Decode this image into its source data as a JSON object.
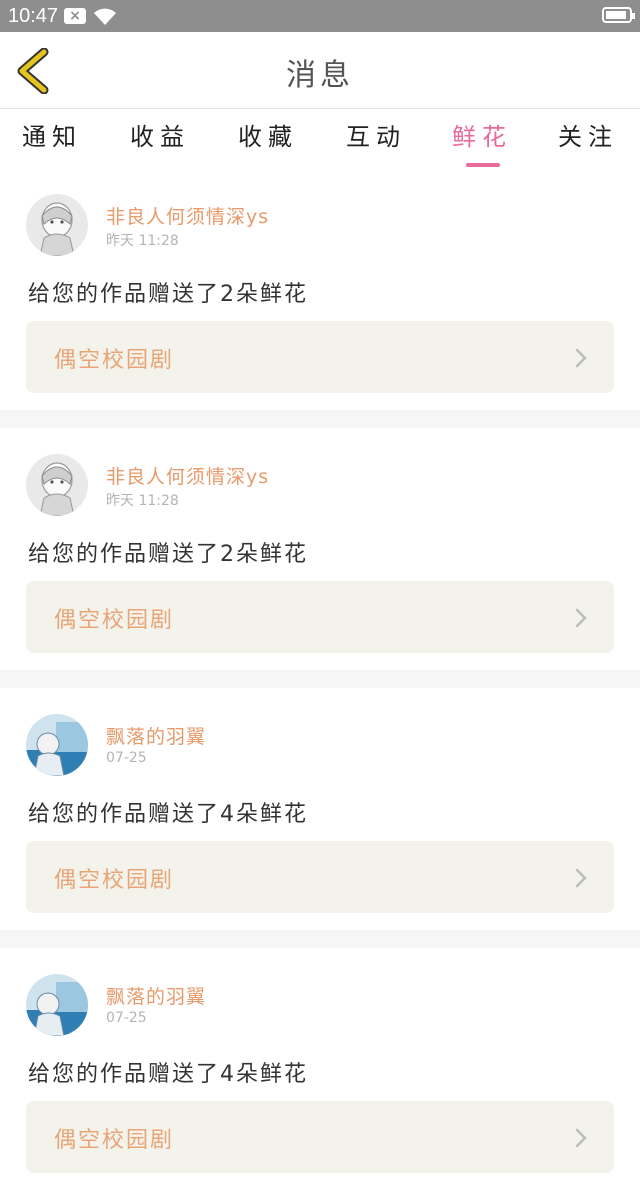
{
  "status_bar": {
    "time": "10:47",
    "notification_icon": "x-notification-icon",
    "wifi_icon": "wifi-icon",
    "battery_icon": "battery-icon"
  },
  "header": {
    "title": "消息",
    "back_icon": "chevron-left-icon"
  },
  "tabs": [
    {
      "label": "通知",
      "active": false
    },
    {
      "label": "收益",
      "active": false
    },
    {
      "label": "收藏",
      "active": false
    },
    {
      "label": "互动",
      "active": false
    },
    {
      "label": "鲜花",
      "active": true
    },
    {
      "label": "关注",
      "active": false
    }
  ],
  "messages": [
    {
      "user": "非良人何须情深ys",
      "time": "昨天 11:28",
      "text": "给您的作品赠送了2朵鲜花",
      "work": "偶空校园剧",
      "avatar": "anime-girl-avatar"
    },
    {
      "user": "非良人何须情深ys",
      "time": "昨天 11:28",
      "text": "给您的作品赠送了2朵鲜花",
      "work": "偶空校园剧",
      "avatar": "anime-girl-avatar"
    },
    {
      "user": "飘落的羽翼",
      "time": "07-25",
      "text": "给您的作品赠送了4朵鲜花",
      "work": "偶空校园剧",
      "avatar": "anime-blue-avatar"
    },
    {
      "user": "飘落的羽翼",
      "time": "07-25",
      "text": "给您的作品赠送了4朵鲜花",
      "work": "偶空校园剧",
      "avatar": "anime-blue-avatar"
    }
  ],
  "colors": {
    "accent": "#e8699a",
    "username": "#e89a6a",
    "work_title": "#e8a577",
    "work_bg": "#f3f3ec",
    "back_icon": "#e6c41e"
  }
}
